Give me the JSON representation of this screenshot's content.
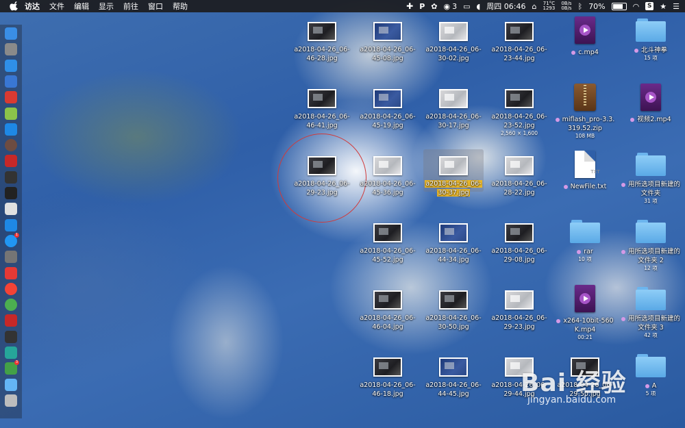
{
  "menubar": {
    "items": [
      "访达",
      "文件",
      "编辑",
      "显示",
      "前往",
      "窗口",
      "帮助"
    ],
    "wechat_count": "3",
    "weekday_time": "周四 06:46",
    "temp": "71°C",
    "fan": "1293",
    "net_up": "0B/s",
    "net_down": "0B/s",
    "battery": "70%"
  },
  "dock": {
    "icons": [
      "finder-icon",
      "launchpad-icon",
      "safari-icon",
      "contacts-icon",
      "netease-music-icon",
      "android-icon",
      "teamviewer-icon",
      "clock-icon",
      "baidu-icon",
      "activity-monitor-icon",
      "terminal-icon",
      "preview-icon",
      "mic-icon",
      "app-store-icon",
      "system-preferences-icon",
      "netease-cloud-icon",
      "yandex-icon",
      "chrome-icon",
      "vivaldi-icon",
      "terminal2-icon",
      "mirror-icon",
      "wechat-icon",
      "folder-icon",
      "trash-icon"
    ],
    "colors": [
      "#3a8ee6",
      "#8a8a8a",
      "#2f8fe8",
      "#3977d3",
      "#d93a32",
      "#8bc34a",
      "#1e88e5",
      "#6d4c41",
      "#c62828",
      "#333333",
      "#222222",
      "#e0e0e0",
      "#1e88e5",
      "#2196f3",
      "#757575",
      "#e53935",
      "#f44336",
      "#4caf50",
      "#c62828",
      "#333333",
      "#26a69a",
      "#43a047",
      "#64b5f6",
      "#bdbdbd"
    ]
  },
  "desktop": {
    "images": [
      {
        "line1": "a2018-04-26_06-",
        "line2": "46-28.jpg",
        "style": "dark"
      },
      {
        "line1": "a2018-04-26_06-",
        "line2": "45-08.jpg",
        "style": "blue"
      },
      {
        "line1": "a2018-04-26_06-",
        "line2": "30-02.jpg",
        "style": "light"
      },
      {
        "line1": "a2018-04-26_06-",
        "line2": "23-44.jpg",
        "style": "dark"
      },
      {
        "line1": "a2018-04-26_06-",
        "line2": "46-41.jpg",
        "style": "dark"
      },
      {
        "line1": "a2018-04-26_06-",
        "line2": "45-19.jpg",
        "style": "blue"
      },
      {
        "line1": "a2018-04-26_06-",
        "line2": "30-17.jpg",
        "style": "light"
      },
      {
        "line1": "a2018-04-26_06-",
        "line2": "23-52.jpg",
        "style": "dark",
        "sub": "2,560 × 1,600"
      },
      {
        "line1": "a2018-04-26_06-",
        "line2": "29-23.jpg",
        "style": "dark"
      },
      {
        "line1": "a2018-04-26_06-",
        "line2": "45-36.jpg",
        "style": "light"
      },
      {
        "line1": "a2018-04-26_06-",
        "line2": "30-37.jpg",
        "style": "light",
        "selected": true
      },
      {
        "line1": "a2018-04-26_06-",
        "line2": "28-22.jpg",
        "style": "light"
      },
      {
        "line1": "a2018-04-26_06-",
        "line2": "45-52.jpg",
        "style": "dark"
      },
      {
        "line1": "a2018-04-26_06-",
        "line2": "44-34.jpg",
        "style": "blue"
      },
      {
        "line1": "a2018-04-26_06-",
        "line2": "29-08.jpg",
        "style": "dark"
      },
      {
        "line1": "a2018-04-26_06-",
        "line2": "46-04.jpg",
        "style": "dark"
      },
      {
        "line1": "a2018-04-26_06-",
        "line2": "30-50.jpg",
        "style": "dark"
      },
      {
        "line1": "a2018-04-26_06-",
        "line2": "29-23.jpg",
        "style": "light"
      },
      {
        "line1": "a2018-04-26_06-",
        "line2": "46-18.jpg",
        "style": "dark"
      },
      {
        "line1": "a2018-04-26_06-",
        "line2": "44-45.jpg",
        "style": "blue"
      },
      {
        "line1": "a2018-04-26_06-",
        "line2": "29-44.jpg",
        "style": "light"
      },
      {
        "line1": "a2018-04-26_06-",
        "line2": "29-50.jpg",
        "style": "dark"
      }
    ],
    "files": [
      {
        "type": "video",
        "name": "c.mp4",
        "tag": true
      },
      {
        "type": "folder",
        "name": "北斗神拳",
        "tag": true,
        "sub": "15 项"
      },
      {
        "type": "zip",
        "name": "miflash_pro-3.3.",
        "name2": "319.52.zip",
        "tag": true,
        "sub": "108 MB"
      },
      {
        "type": "video",
        "name": "视频2.mp4",
        "tag": true
      },
      {
        "type": "doc",
        "name": "NewFile.txt",
        "tag": true,
        "doc_label": "TXT"
      },
      {
        "type": "folder",
        "name": "用所选项目新建的",
        "name2": "文件夹",
        "tag": true,
        "sub": "31 项"
      },
      {
        "type": "folder",
        "name": "rar",
        "tag": true,
        "sub": "10 项"
      },
      {
        "type": "folder",
        "name": "用所选项目新建的",
        "name2": "文件夹 2",
        "tag": true,
        "sub": "12 项"
      },
      {
        "type": "video",
        "name": "x264-10bit-560",
        "name2": "K.mp4",
        "tag": true,
        "sub": "00:21"
      },
      {
        "type": "folder",
        "name": "用所选项目新建的",
        "name2": "文件夹 3",
        "tag": true,
        "sub": "42 项"
      },
      {
        "type": "folder",
        "name": "A",
        "tag": true,
        "sub": "5 项"
      }
    ]
  },
  "watermark": {
    "logo": "Bai 经验",
    "url": "jingyan.baidu.com"
  }
}
